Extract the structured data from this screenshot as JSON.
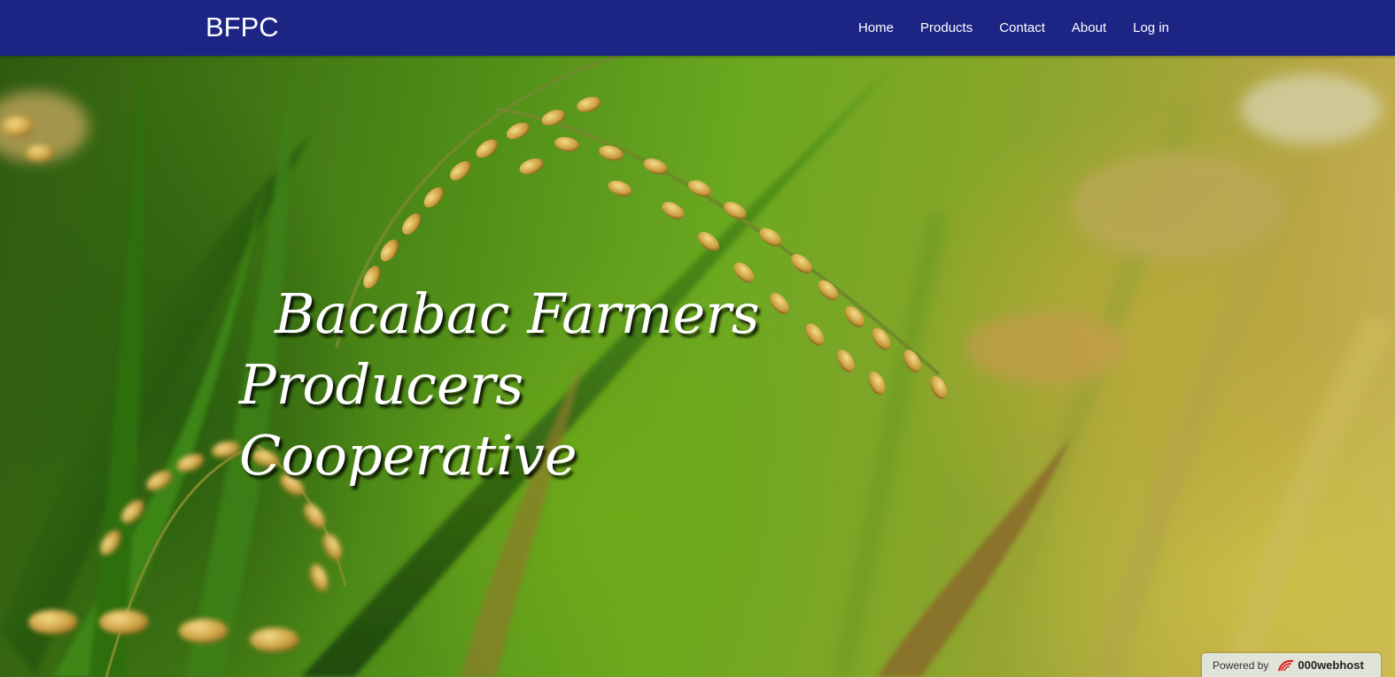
{
  "navbar": {
    "brand": "BFPC",
    "links": [
      "Home",
      "Products",
      "Contact",
      "About",
      "Log in"
    ]
  },
  "hero": {
    "headline_line1": "Bacabac Farmers",
    "headline_line2": "Producers Cooperative",
    "background": "rice-field-photo"
  },
  "badge": {
    "prefix": "Powered by",
    "host": "000webhost",
    "icon": "000webhost-logo-icon"
  },
  "colors": {
    "navbar_bg": "#1c2484",
    "nav_text": "#ffffff",
    "badge_bg": "#dfe3d8",
    "logo_red": "#d8231f"
  }
}
